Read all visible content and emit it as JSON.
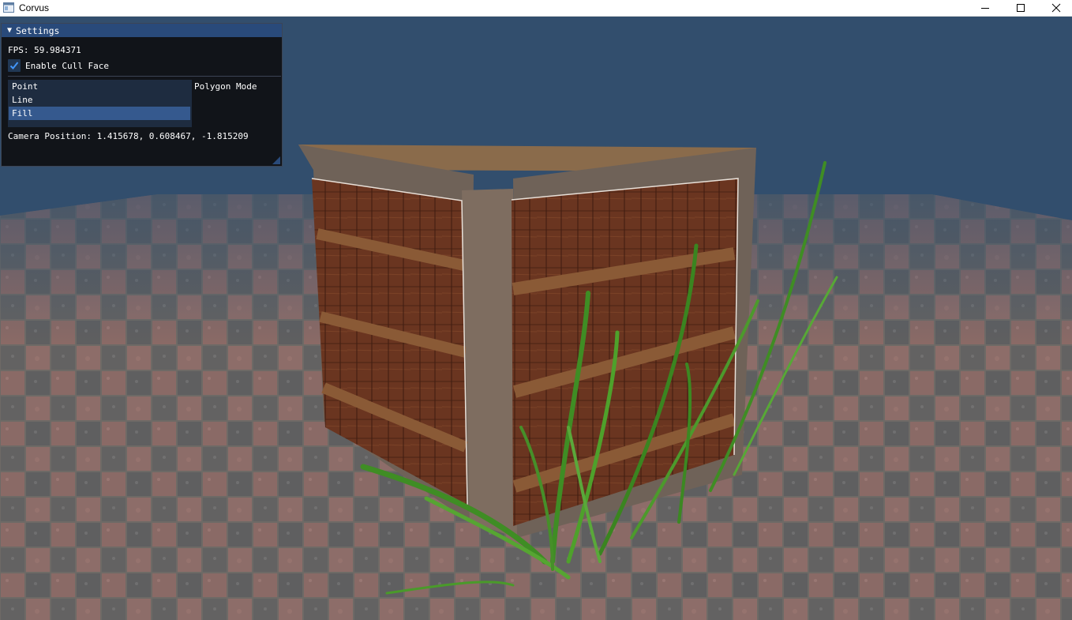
{
  "window": {
    "title": "Corvus",
    "controls": {
      "minimize": "minimize",
      "maximize": "maximize",
      "close": "close"
    }
  },
  "settings_panel": {
    "title": "Settings",
    "fps_text": "FPS: 59.984371",
    "cull_face": {
      "label": "Enable Cull Face",
      "checked": true
    },
    "polygon_mode": {
      "label": "Polygon Mode",
      "options": [
        "Point",
        "Line",
        "Fill"
      ],
      "selected": "Fill"
    },
    "camera_text": "Camera Position: 1.415678, 0.608467, -1.815209"
  },
  "scene": {
    "sky_color": "#324e6d",
    "objects": [
      "checkered-stone-floor",
      "wooden-crate",
      "grass-clump"
    ]
  },
  "colors": {
    "panel_header": "#294a7a",
    "panel_bg": "#0f1114",
    "selected_item": "#35598e",
    "listbox_bg": "#1e2c40",
    "check_accent": "#4296fa"
  }
}
